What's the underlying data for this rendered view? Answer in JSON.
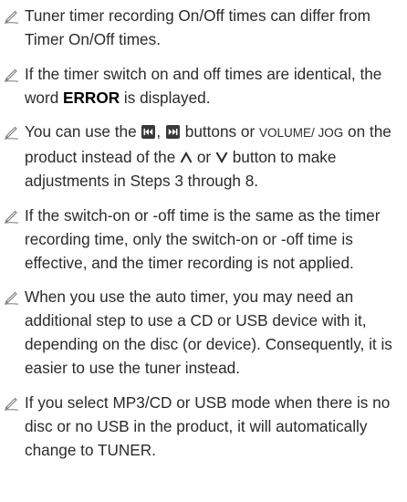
{
  "notes": [
    {
      "text": "Tuner timer recording On/Off times can differ from Timer On/Off times."
    },
    {
      "before": "If the timer switch on and off times are identical, the word ",
      "bold": "ERROR",
      "after": " is displayed."
    },
    {
      "before": "You can use the ",
      "sep1": ", ",
      "mid1": " buttons or ",
      "caps": "VOLUME/ JOG",
      "mid2": " on the product instead of the ",
      "or": " or ",
      "after": " button to make adjustments in Steps 3 through 8.",
      "prev_icon": "skip-previous-icon",
      "next_icon": "skip-next-icon",
      "up_icon": "caret-up-icon",
      "down_icon": "caret-down-icon"
    },
    {
      "text": "If the switch-on or -off time is the same as the timer recording time, only the switch-on or -off time is effective, and the timer recording is not applied."
    },
    {
      "text": "When you use the auto timer, you may need an additional step to use a CD or USB device with it, depending on the disc (or device). Consequently, it is easier to use the tuner instead."
    },
    {
      "text": "If you select MP3/CD or USB mode when there is no disc or no USB in the product, it will automatically change to TUNER."
    }
  ],
  "icon": "note-pencil-icon",
  "colors": {
    "text": "#2b2b2b",
    "icon": "#7a7a7a",
    "button_icon_bg": "#3a3a3a"
  }
}
